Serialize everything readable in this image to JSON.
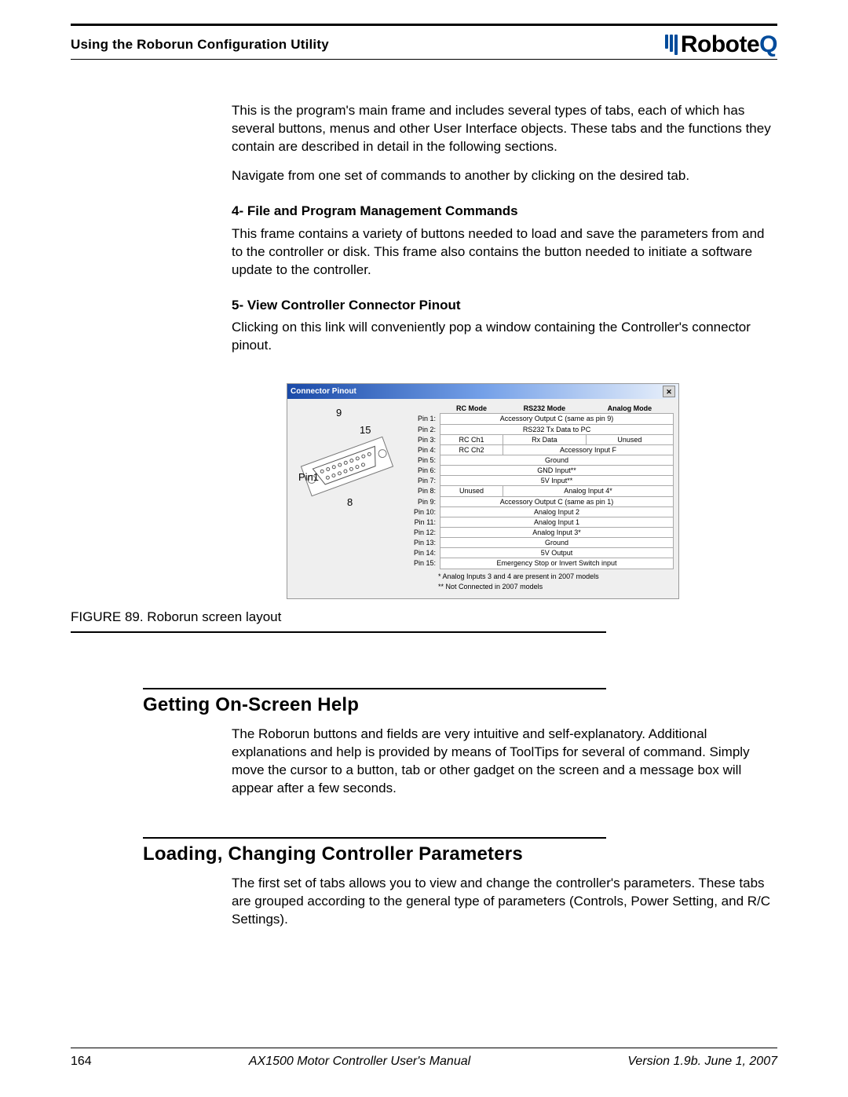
{
  "header": {
    "section": "Using the Roborun Configuration Utility",
    "brand": "Robote",
    "brand_q": "Q"
  },
  "intro_p1": "This is the program's main frame and includes several types of tabs, each of which has several buttons, menus and other User Interface objects. These tabs and the functions they contain are described in detail in the following sections.",
  "intro_p2": "Navigate from one set of commands to another by clicking on the desired tab.",
  "sec4_h": "4- File and Program Management Commands",
  "sec4_p": "This frame contains a variety of buttons needed to load and save the parameters from and to the controller or disk. This frame also contains the button needed to initiate a software update to the controller.",
  "sec5_h": "5- View Controller Connector Pinout",
  "sec5_p": "Clicking on this link will conveniently pop a window containing the Controller's connector pinout.",
  "pinout": {
    "title": "Connector Pinout",
    "cols": [
      "RC Mode",
      "RS232 Mode",
      "Analog Mode"
    ],
    "labels": {
      "top": "9",
      "mid": "15",
      "bot": "8",
      "pin1": "Pin1"
    },
    "rows": [
      {
        "pin": "Pin 1:",
        "cells": [
          {
            "t": "Accessory Output C (same as pin 9)",
            "span": 3
          }
        ]
      },
      {
        "pin": "Pin 2:",
        "cells": [
          {
            "t": "RS232 Tx Data to PC",
            "span": 3
          }
        ]
      },
      {
        "pin": "Pin 3:",
        "cells": [
          {
            "t": "RC Ch1"
          },
          {
            "t": "Rx Data"
          },
          {
            "t": "Unused"
          }
        ]
      },
      {
        "pin": "Pin 4:",
        "cells": [
          {
            "t": "RC Ch2"
          },
          {
            "t": "Accessory Input F",
            "span": 2
          }
        ]
      },
      {
        "pin": "Pin 5:",
        "cells": [
          {
            "t": "Ground",
            "span": 3
          }
        ]
      },
      {
        "pin": "Pin 6:",
        "cells": [
          {
            "t": "GND Input**",
            "span": 3
          }
        ]
      },
      {
        "pin": "Pin 7:",
        "cells": [
          {
            "t": "5V Input**",
            "span": 3
          }
        ]
      },
      {
        "pin": "Pin 8:",
        "cells": [
          {
            "t": "Unused"
          },
          {
            "t": "Analog Input 4*",
            "span": 2
          }
        ]
      },
      {
        "pin": "Pin 9:",
        "cells": [
          {
            "t": "Accessory Output C (same as pin 1)",
            "span": 3
          }
        ]
      },
      {
        "pin": "Pin 10:",
        "cells": [
          {
            "t": "Analog Input 2",
            "span": 3
          }
        ]
      },
      {
        "pin": "Pin 11:",
        "cells": [
          {
            "t": "Analog Input 1",
            "span": 3
          }
        ]
      },
      {
        "pin": "Pin 12:",
        "cells": [
          {
            "t": "Analog Input 3*",
            "span": 3
          }
        ]
      },
      {
        "pin": "Pin 13:",
        "cells": [
          {
            "t": "Ground",
            "span": 3
          }
        ]
      },
      {
        "pin": "Pin 14:",
        "cells": [
          {
            "t": "5V Output",
            "span": 3
          }
        ]
      },
      {
        "pin": "Pin 15:",
        "cells": [
          {
            "t": "Emergency Stop or Invert Switch input",
            "span": 3
          }
        ]
      }
    ],
    "note1": "* Analog Inputs 3 and 4 are present in 2007 models",
    "note2": "** Not Connected in 2007 models"
  },
  "fig_caption": "FIGURE 89.  Roborun screen layout",
  "h2_help": "Getting On-Screen Help",
  "help_p": "The Roborun buttons and fields are very intuitive and self-explanatory. Additional explanations and help is provided by means of ToolTips for several of command. Simply move the cursor to a button, tab or other gadget on the screen and a message box will appear after a few seconds.",
  "h2_load": "Loading, Changing Controller Parameters",
  "load_p": "The first set of tabs allows you to view and change the controller's parameters. These tabs are grouped according to the general type of parameters (Controls, Power Setting, and R/C Settings).",
  "footer": {
    "page": "164",
    "title": "AX1500 Motor Controller User's Manual",
    "ver": "Version 1.9b. June 1, 2007"
  }
}
